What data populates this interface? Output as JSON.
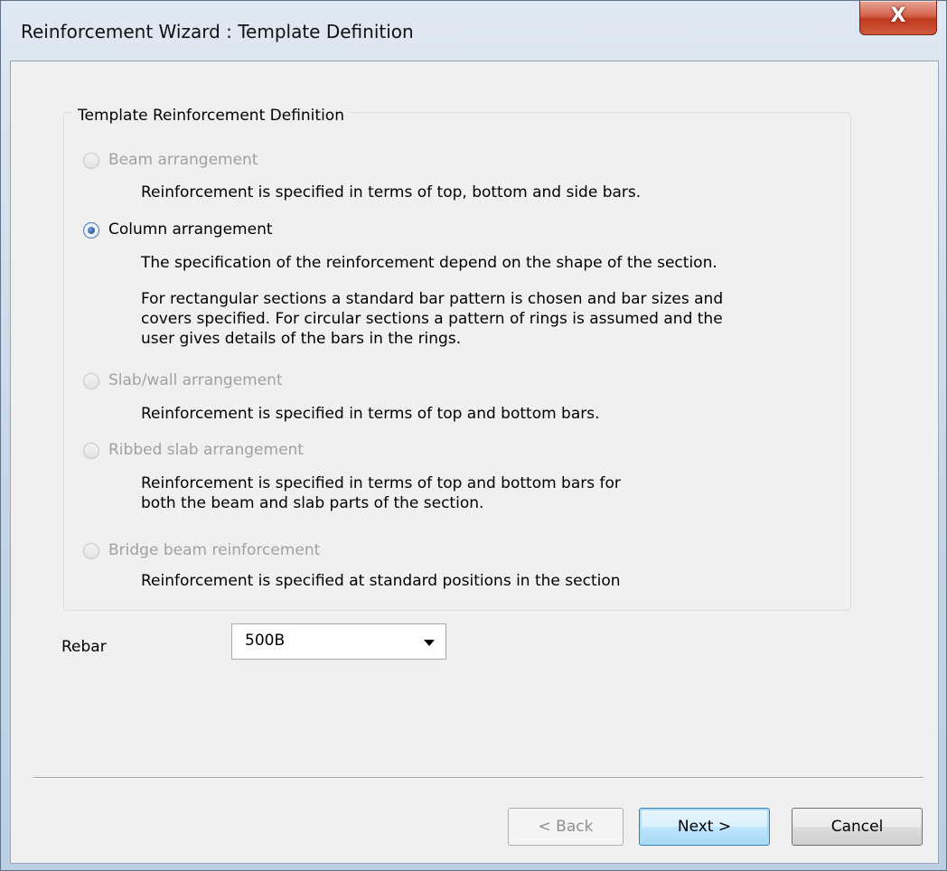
{
  "window": {
    "title": "Reinforcement Wizard : Template Definition",
    "close_label": "X"
  },
  "group": {
    "title": "Template Reinforcement Definition"
  },
  "options": [
    {
      "label": "Beam arrangement",
      "enabled": false,
      "selected": false,
      "desc": [
        "Reinforcement is specified in terms of top, bottom and side bars."
      ]
    },
    {
      "label": "Column arrangement",
      "enabled": true,
      "selected": true,
      "desc": [
        "The specification of the reinforcement depend on the shape of the section.",
        "For rectangular sections a standard bar pattern is chosen and bar sizes and",
        "covers specified. For circular sections a pattern of rings is assumed and the",
        "user gives details of the bars in the rings."
      ]
    },
    {
      "label": "Slab/wall arrangement",
      "enabled": false,
      "selected": false,
      "desc": [
        "Reinforcement is specified in terms of top and bottom bars."
      ]
    },
    {
      "label": "Ribbed slab arrangement",
      "enabled": false,
      "selected": false,
      "desc": [
        "Reinforcement is specified in terms of top and bottom bars for",
        "both the beam and slab parts of the section."
      ]
    },
    {
      "label": "Bridge beam reinforcement",
      "enabled": false,
      "selected": false,
      "desc": [
        "Reinforcement is specified at standard positions in the section"
      ]
    }
  ],
  "rebar": {
    "label": "Rebar",
    "value": "500B"
  },
  "buttons": {
    "back": "< Back",
    "next": "Next >",
    "cancel": "Cancel"
  }
}
